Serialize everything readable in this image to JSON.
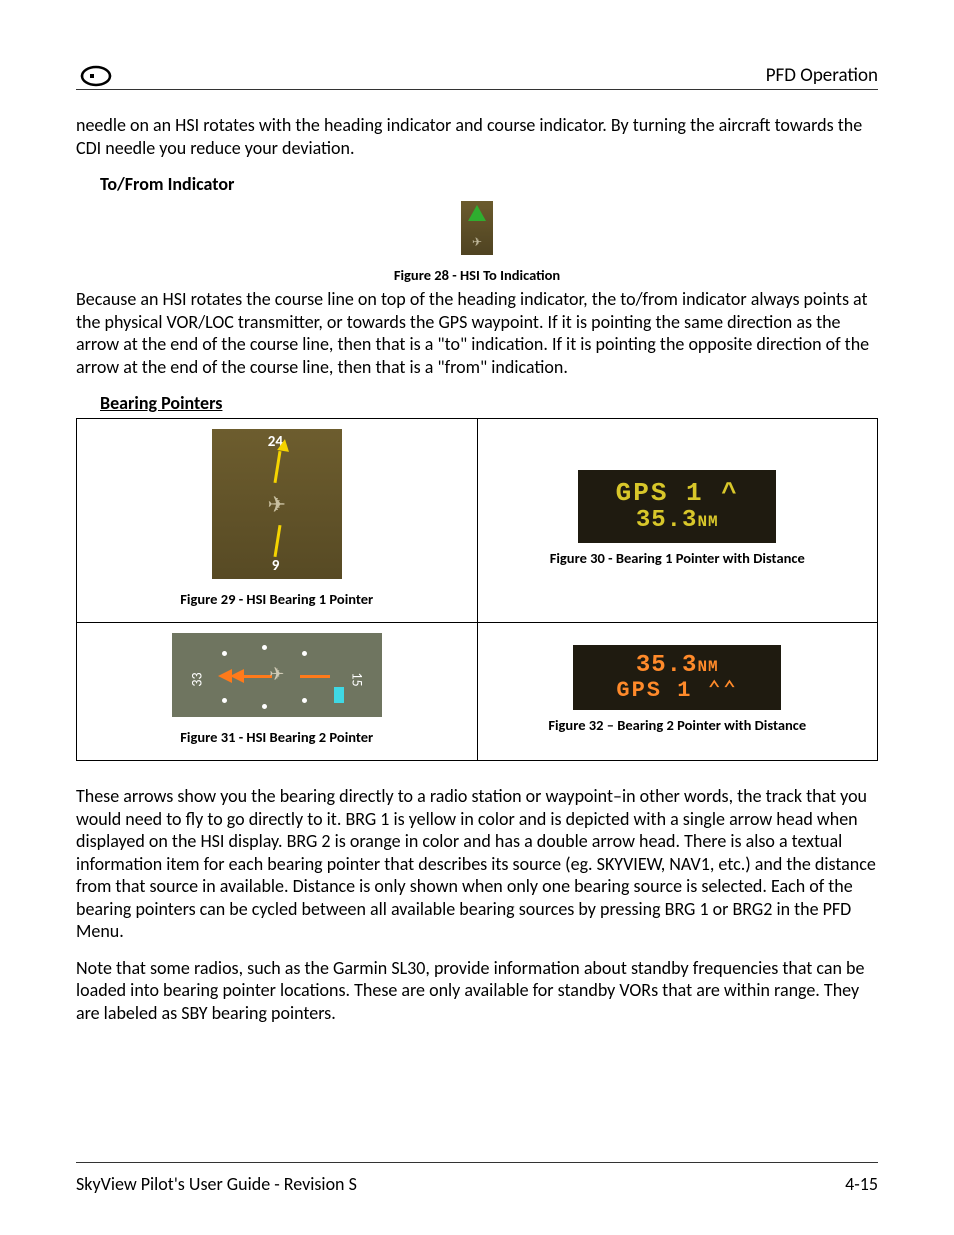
{
  "header": {
    "title": "PFD Operation"
  },
  "intro_paragraph": "needle on an HSI rotates with the heading indicator and course indicator. By turning the aircraft towards the CDI needle you reduce your deviation.",
  "sections": {
    "to_from": {
      "heading": "To/From Indicator",
      "caption": "Figure 28 - HSI To Indication",
      "paragraph": "Because an HSI rotates the course line on top of the heading indicator, the to/from indicator always points at the physical VOR/LOC transmitter, or towards the GPS waypoint. If it is pointing the same direction as the arrow at the end of the course line, then that is a \"to\" indication. If it is pointing the opposite direction of the arrow at the end of the course line, then that is a \"from\" indication."
    },
    "bearing": {
      "heading": "Bearing Pointers",
      "fig29": {
        "n24": "24",
        "n9": "9",
        "caption": "Figure 29 - HSI Bearing 1 Pointer"
      },
      "fig30": {
        "line1": "GPS 1  ^",
        "line2a": "35.3",
        "line2b": "NM",
        "caption": "Figure 30 - Bearing 1 Pointer with Distance"
      },
      "fig31": {
        "t33": "33",
        "t15": "15",
        "caption": "Figure 31 - HSI Bearing 2 Pointer"
      },
      "fig32": {
        "line1a": "35.3",
        "line1b": "NM",
        "line2": "GPS 1   ⌃⌃",
        "caption": "Figure 32 – Bearing 2 Pointer with Distance"
      },
      "para1": "These arrows show you the bearing directly to a radio station or waypoint–in other words, the track that you would need to fly to go directly to it. BRG 1 is yellow in color and is depicted with a single arrow head when displayed on the HSI display. BRG 2 is orange in color and has a double arrow head. There is also a textual information item for each bearing pointer that describes its source (eg. SKYVIEW, NAV1, etc.) and the distance from that source in available. Distance is only shown when only one bearing source is selected. Each of the bearing pointers can be cycled between all available bearing sources by pressing BRG 1 or BRG2 in the PFD Menu.",
      "para2": "Note that some radios, such as the Garmin SL30, provide information about standby frequencies that can be loaded into bearing pointer locations. These are only available for standby VORs that are within range. They are labeled as SBY bearing pointers."
    }
  },
  "footer": {
    "left": "SkyView Pilot's User Guide - Revision S",
    "right": "4-15"
  }
}
